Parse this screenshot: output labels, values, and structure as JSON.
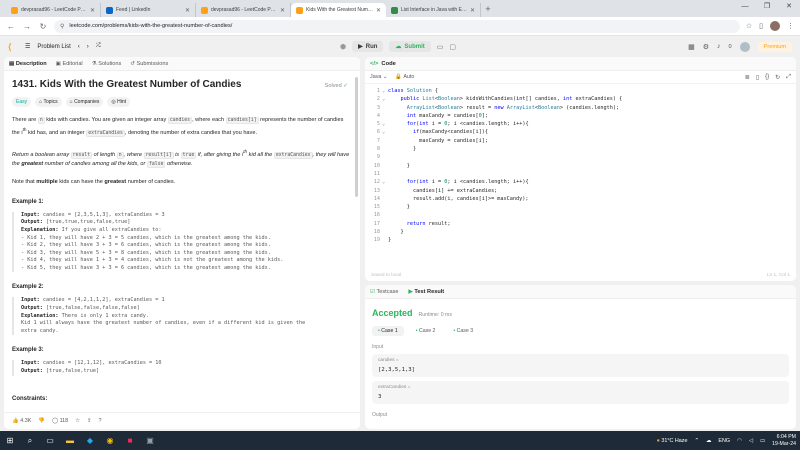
{
  "browser": {
    "tabs": [
      {
        "title": "devprasad96 - LeetCode Profile",
        "color": "#ffa116",
        "active": false
      },
      {
        "title": "Feed | LinkedIn",
        "color": "#0a66c2",
        "active": false
      },
      {
        "title": "devprasad96 - LeetCode Profile",
        "color": "#ffa116",
        "active": false
      },
      {
        "title": "Kids With the Greatest Number",
        "color": "#ffa116",
        "active": true
      },
      {
        "title": "List Interface in Java with Exam",
        "color": "#2f8d46",
        "active": false
      }
    ],
    "url": "leetcode.com/problems/kids-with-the-greatest-number-of-candies/"
  },
  "header": {
    "problem_list": "Problem List",
    "run": "Run",
    "submit": "Submit",
    "count": "0",
    "premium": "Premium"
  },
  "left": {
    "tabs": [
      "Description",
      "Editorial",
      "Solutions",
      "Submissions"
    ],
    "title": "1431. Kids With the Greatest Number of Candies",
    "solved": "Solved",
    "chips": [
      "Easy",
      "Topics",
      "Companies",
      "Hint"
    ],
    "likes": "4.3K",
    "comments": "118",
    "constraints": "Constraints:"
  },
  "code": {
    "header": "Code",
    "language": "Java",
    "mode": "Auto",
    "saved": "Saved to local",
    "position": "Ln 1, Col 1",
    "lines": [
      {
        "n": "1",
        "f": "⌄",
        "t": "class Solution {"
      },
      {
        "n": "2",
        "f": "⌄",
        "t": "    public List<Boolean> kidsWithCandies(int[] candies, int extraCandies) {"
      },
      {
        "n": "3",
        "f": "",
        "t": "      ArrayList<Boolean> result = new ArrayList<Boolean> (candies.length);"
      },
      {
        "n": "4",
        "f": "",
        "t": "      int maxCandy = candies[0];"
      },
      {
        "n": "5",
        "f": "⌄",
        "t": "      for(int i = 0; i <candies.length; i++){"
      },
      {
        "n": "6",
        "f": "⌄",
        "t": "        if(maxCandy<candies[i]){"
      },
      {
        "n": "7",
        "f": "",
        "t": "          maxCandy = candies[i];"
      },
      {
        "n": "8",
        "f": "",
        "t": "        }"
      },
      {
        "n": "9",
        "f": "",
        "t": ""
      },
      {
        "n": "10",
        "f": "",
        "t": "      }"
      },
      {
        "n": "11",
        "f": "",
        "t": ""
      },
      {
        "n": "12",
        "f": "⌄",
        "t": "      for(int i = 0; i <candies.length; i++){"
      },
      {
        "n": "13",
        "f": "",
        "t": "        candies[i] += extraCandies;"
      },
      {
        "n": "14",
        "f": "",
        "t": "        result.add(i, candies[i]>= maxCandy);"
      },
      {
        "n": "15",
        "f": "",
        "t": "      }"
      },
      {
        "n": "16",
        "f": "",
        "t": ""
      },
      {
        "n": "17",
        "f": "",
        "t": "      return result;"
      },
      {
        "n": "18",
        "f": "",
        "t": "    }"
      },
      {
        "n": "19",
        "f": "",
        "t": "}"
      }
    ]
  },
  "test": {
    "tabs": [
      "Testcase",
      "Test Result"
    ],
    "status": "Accepted",
    "runtime": "Runtime: 0 ms",
    "cases": [
      "Case 1",
      "Case 2",
      "Case 3"
    ],
    "input_label": "Input",
    "var1_name": "candies =",
    "var1_value": "[2,3,5,1,3]",
    "var2_name": "extraCandies =",
    "var2_value": "3",
    "output_label": "Output"
  },
  "taskbar": {
    "weather": "31°C  Haze",
    "lang": "ENG",
    "time": "6:04 PM",
    "date": "19-Mar-24"
  }
}
